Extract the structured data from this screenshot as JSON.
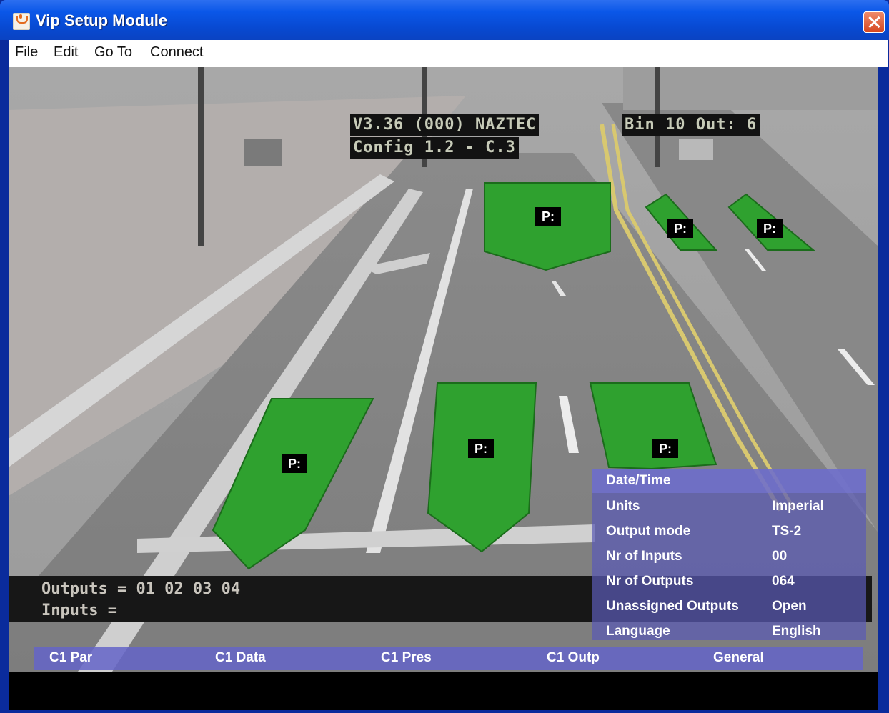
{
  "window": {
    "title": "Vip Setup Module"
  },
  "menu": [
    "File",
    "Edit",
    "Go To",
    "Connect"
  ],
  "osd": {
    "top_left_line1": "V3.36  (000) NAZTEC",
    "top_left_line2": "Config 1.2 - C.3",
    "top_right": "Bin 10 Out: 6",
    "outputs_label": "Outputs = 01 02 03 04",
    "inputs_label": "Inputs ="
  },
  "zone_label": "P:",
  "panel": {
    "header": "Date/Time",
    "rows": [
      {
        "key": "Units",
        "value": "Imperial"
      },
      {
        "key": "Output mode",
        "value": "TS-2"
      },
      {
        "key": "Nr of Inputs",
        "value": "00"
      },
      {
        "key": "Nr of Outputs",
        "value": "064"
      },
      {
        "key": "Unassigned Outputs",
        "value": "Open"
      },
      {
        "key": "Language",
        "value": "English"
      }
    ]
  },
  "tabs": [
    "C1 Par",
    "C1 Data",
    "C1 Pres",
    "C1 Outp",
    "General"
  ],
  "colors": {
    "zone_fill": "#2fa12f",
    "title_bar": "#0a57e8",
    "panel": "#5a5ab4"
  }
}
